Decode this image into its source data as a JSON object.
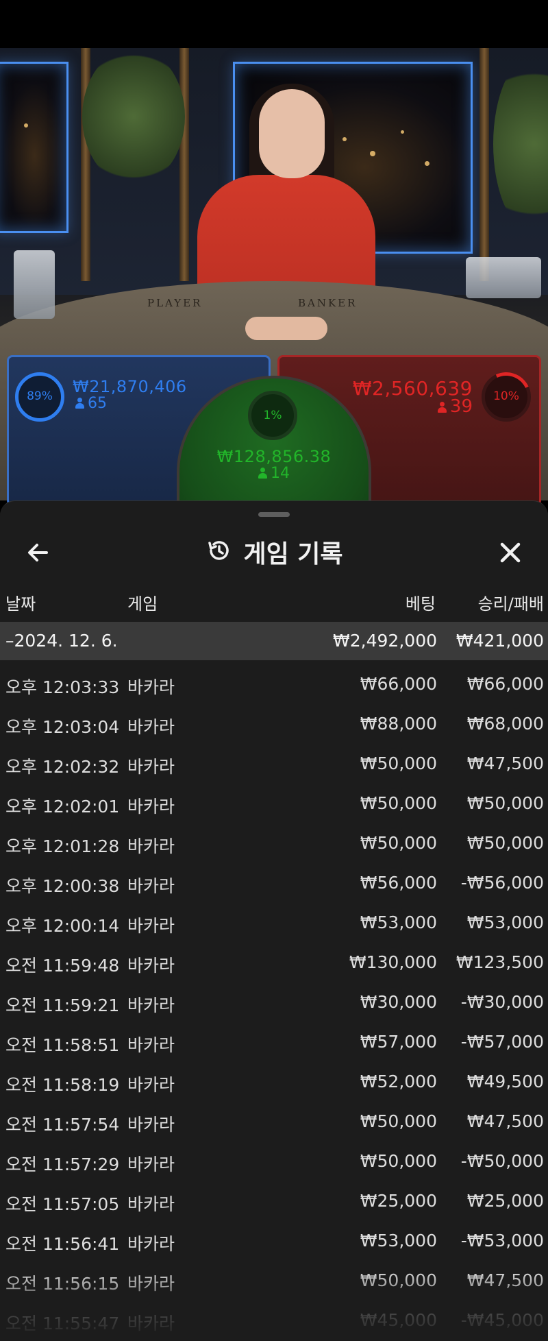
{
  "bets": {
    "player": {
      "percent": "89%",
      "amount": "₩21,870,406",
      "players": "65",
      "color": "#2f7ef0"
    },
    "tie": {
      "percent": "1%",
      "amount": "₩128,856.38",
      "players": "14",
      "color": "#22b52a"
    },
    "banker": {
      "percent": "10%",
      "amount": "₩2,560,639",
      "players": "39",
      "color": "#e02525"
    }
  },
  "table_labels": {
    "player": "PLAYER",
    "banker": "BANKER"
  },
  "sheet": {
    "title": "게임 기록",
    "back_icon": "arrow-left-icon",
    "history_icon": "history-icon",
    "close_icon": "close-icon",
    "columns": {
      "date": "날짜",
      "game": "게임",
      "bet": "베팅",
      "result": "승리/패배"
    },
    "date_group": {
      "date": "–2024. 12. 6.",
      "bet_total": "₩2,492,000",
      "result_total": "₩421,000"
    },
    "rows": [
      {
        "time": "오후 12:03:33",
        "game": "바카라",
        "bet": "₩66,000",
        "result": "₩66,000"
      },
      {
        "time": "오후 12:03:04",
        "game": "바카라",
        "bet": "₩88,000",
        "result": "₩68,000"
      },
      {
        "time": "오후 12:02:32",
        "game": "바카라",
        "bet": "₩50,000",
        "result": "₩47,500"
      },
      {
        "time": "오후 12:02:01",
        "game": "바카라",
        "bet": "₩50,000",
        "result": "₩50,000"
      },
      {
        "time": "오후 12:01:28",
        "game": "바카라",
        "bet": "₩50,000",
        "result": "₩50,000"
      },
      {
        "time": "오후 12:00:38",
        "game": "바카라",
        "bet": "₩56,000",
        "result": "-₩56,000"
      },
      {
        "time": "오후 12:00:14",
        "game": "바카라",
        "bet": "₩53,000",
        "result": "₩53,000"
      },
      {
        "time": "오전 11:59:48",
        "game": "바카라",
        "bet": "₩130,000",
        "result": "₩123,500"
      },
      {
        "time": "오전 11:59:21",
        "game": "바카라",
        "bet": "₩30,000",
        "result": "-₩30,000"
      },
      {
        "time": "오전 11:58:51",
        "game": "바카라",
        "bet": "₩57,000",
        "result": "-₩57,000"
      },
      {
        "time": "오전 11:58:19",
        "game": "바카라",
        "bet": "₩52,000",
        "result": "₩49,500"
      },
      {
        "time": "오전 11:57:54",
        "game": "바카라",
        "bet": "₩50,000",
        "result": "₩47,500"
      },
      {
        "time": "오전 11:57:29",
        "game": "바카라",
        "bet": "₩50,000",
        "result": "-₩50,000"
      },
      {
        "time": "오전 11:57:05",
        "game": "바카라",
        "bet": "₩25,000",
        "result": "₩25,000"
      },
      {
        "time": "오전 11:56:41",
        "game": "바카라",
        "bet": "₩53,000",
        "result": "-₩53,000"
      },
      {
        "time": "오전 11:56:15",
        "game": "바카라",
        "bet": "₩50,000",
        "result": "₩47,500"
      },
      {
        "time": "오전 11:55:47",
        "game": "바카라",
        "bet": "₩45,000",
        "result": "-₩45,000"
      }
    ]
  }
}
